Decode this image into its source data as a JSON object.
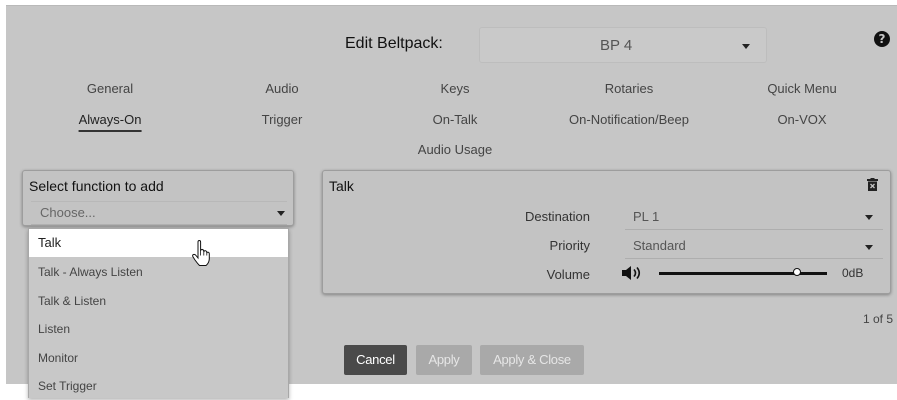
{
  "header": {
    "title": "Edit Beltpack:",
    "beltpack_value": "BP 4",
    "help_glyph": "?"
  },
  "tabs": {
    "row1": [
      "General",
      "Audio",
      "Keys",
      "Rotaries",
      "Quick Menu"
    ],
    "row2": [
      "Always-On",
      "Trigger",
      "On-Talk",
      "On-Notification/Beep",
      "On-VOX"
    ],
    "row3": [
      "Audio Usage"
    ],
    "active": "Always-On"
  },
  "function_picker": {
    "title": "Select function to add",
    "placeholder": "Choose...",
    "options": [
      "Talk",
      "Talk - Always Listen",
      "Talk & Listen",
      "Listen",
      "Monitor",
      "Set Trigger"
    ],
    "highlighted": "Talk"
  },
  "talk_panel": {
    "title": "Talk",
    "destination_label": "Destination",
    "destination_value": "PL 1",
    "priority_label": "Priority",
    "priority_value": "Standard",
    "volume_label": "Volume",
    "volume_value": "0dB",
    "volume_level": 0.82
  },
  "pager": "1 of 5",
  "buttons": {
    "cancel": "Cancel",
    "apply": "Apply",
    "apply_close": "Apply & Close"
  },
  "icons": {
    "help": "help-icon",
    "trash": "trash-icon",
    "speaker": "speaker-icon",
    "cursor": "hand-cursor-icon"
  },
  "colors": {
    "background": "#c6c6c6",
    "highlight": "#ffffff",
    "cancel_button": "#4a4a4a",
    "disabled_button": "#a9a9a9"
  }
}
